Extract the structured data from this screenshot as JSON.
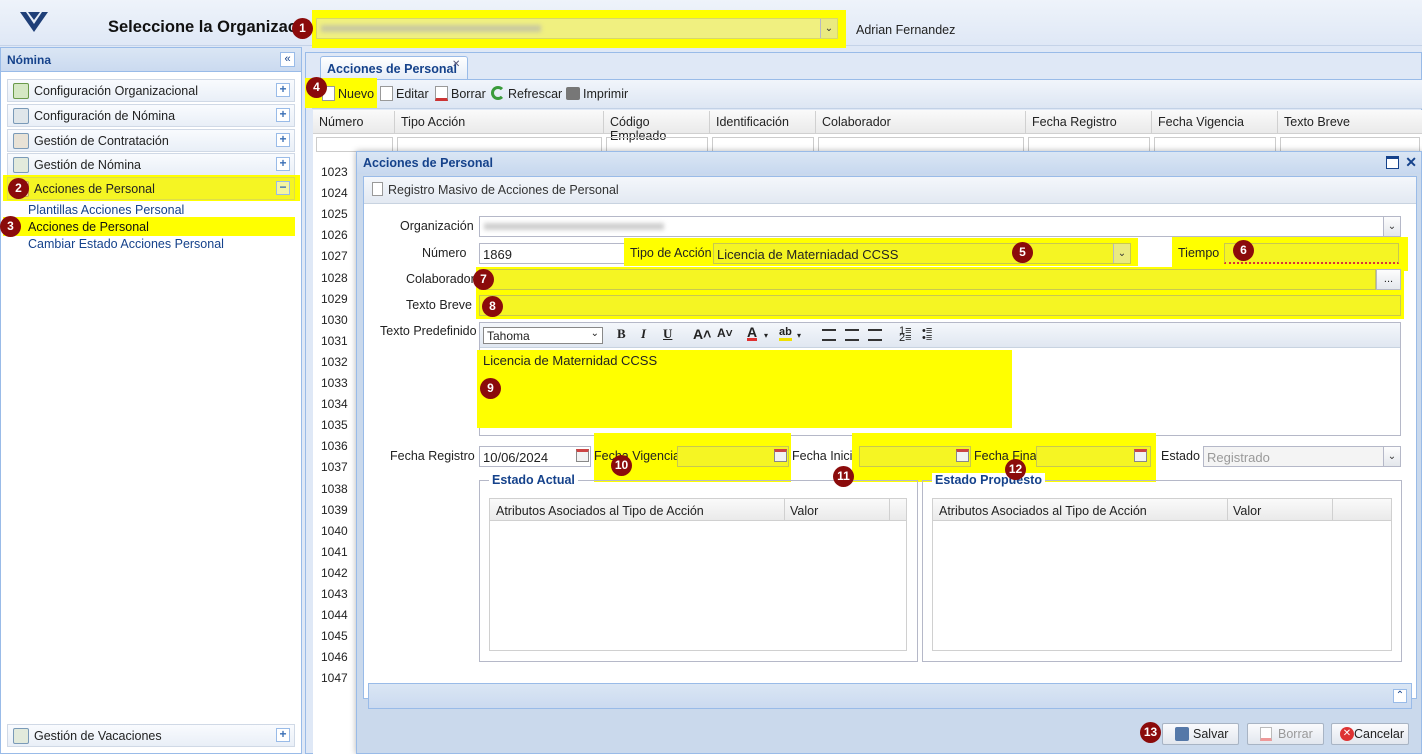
{
  "header": {
    "title": "Seleccione la Organización",
    "org_value": "",
    "user": "Adrian Fernandez"
  },
  "sidebar": {
    "title": "Nómina",
    "collapse_glyph": "«",
    "items": [
      {
        "label": "Configuración Organizacional",
        "icon": "home-icon"
      },
      {
        "label": "Configuración de Nómina",
        "icon": "tools-icon"
      },
      {
        "label": "Gestión de Contratación",
        "icon": "people-icon"
      },
      {
        "label": "Gestión de Nómina",
        "icon": "payroll-icon"
      },
      {
        "label": "Acciones de Personal",
        "icon": "folder-icon"
      }
    ],
    "subitems": [
      "Plantillas Acciones Personal",
      "Acciones de Personal",
      "Cambiar Estado Acciones Personal"
    ],
    "bottom_item": "Gestión de Vacaciones"
  },
  "tab": {
    "label": "Acciones de Personal"
  },
  "toolbar": {
    "nuevo": "Nuevo",
    "editar": "Editar",
    "borrar": "Borrar",
    "refrescar": "Refrescar",
    "imprimir": "Imprimir"
  },
  "grid": {
    "columns": [
      "Número",
      "Tipo Acción",
      "Código Empleado",
      "Identificación",
      "Colaborador",
      "Fecha Registro",
      "Fecha Vigencia",
      "Texto Breve"
    ],
    "rows": [
      "1023",
      "1024",
      "1025",
      "1026",
      "1027",
      "1028",
      "1029",
      "1030",
      "1031",
      "1032",
      "1033",
      "1034",
      "1035",
      "1036",
      "1037",
      "1038",
      "1039",
      "1040",
      "1041",
      "1042",
      "1043",
      "1044",
      "1045",
      "1046",
      "1047"
    ]
  },
  "dialog": {
    "title": "Acciones de Personal",
    "subtoolbar": "Registro Masivo de Acciones de Personal",
    "labels": {
      "organizacion": "Organización",
      "numero": "Número",
      "tipo_accion": "Tipo de Acción",
      "tiempo": "Tiempo",
      "colaborador": "Colaborador",
      "texto_breve": "Texto Breve",
      "texto_predefinido": "Texto Predefinido",
      "fecha_registro": "Fecha Registro",
      "fecha_vigencia": "Fecha Vigencia",
      "fecha_inicial": "Fecha Inicial",
      "fecha_final": "Fecha Final",
      "estado": "Estado"
    },
    "values": {
      "numero": "1869",
      "tipo_accion": "Licencia de Materniadad CCSS",
      "fecha_registro": "10/06/2024",
      "estado": "Registrado",
      "editor_text": "Licencia de Maternidad CCSS",
      "font": "Tahoma",
      "colaborador_btn": "..."
    },
    "estado_actual": {
      "title": "Estado Actual",
      "col1": "Atributos Asociados al Tipo de Acción",
      "col2": "Valor"
    },
    "estado_propuesto": {
      "title": "Estado Propuesto",
      "col1": "Atributos Asociados al Tipo de Acción",
      "col2": "Valor"
    },
    "buttons": {
      "salvar": "Salvar",
      "borrar": "Borrar",
      "cancelar": "Cancelar"
    }
  },
  "badges": [
    "1",
    "2",
    "3",
    "4",
    "5",
    "6",
    "7",
    "8",
    "9",
    "10",
    "11",
    "12",
    "13"
  ]
}
